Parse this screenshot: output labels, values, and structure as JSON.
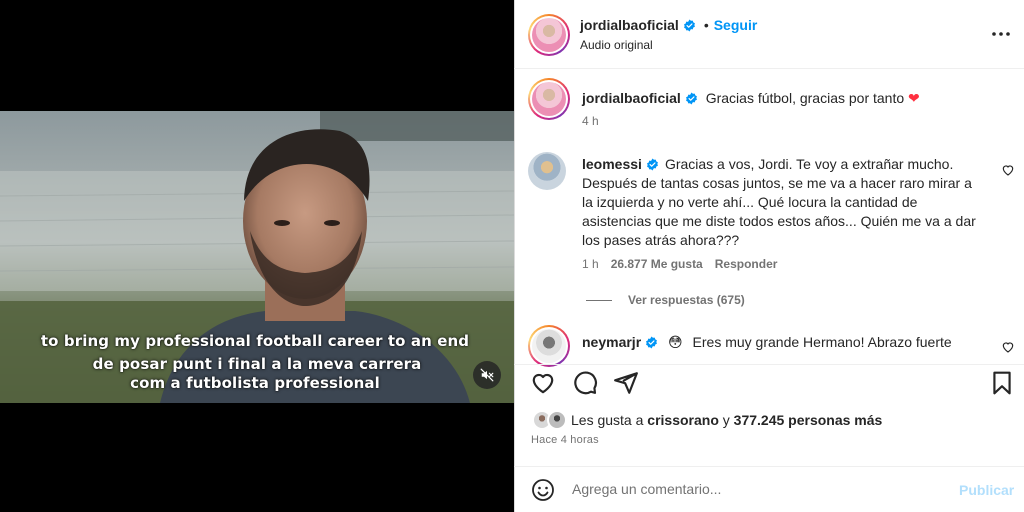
{
  "video": {
    "subtitle_en": "to bring my professional football career to an end",
    "subtitle_ca_1": "de posar punt i final a la meva carrera",
    "subtitle_ca_2": "com a futbolista professional",
    "mute_icon": "speaker-muted-icon"
  },
  "header": {
    "username": "jordialbaoficial",
    "follow_label": "Seguir",
    "dot": "•",
    "audio_label": "Audio original"
  },
  "caption": {
    "username": "jordialbaoficial",
    "text": "Gracias fútbol, gracias por tanto",
    "emoji": "❤",
    "time": "4 h"
  },
  "comments": [
    {
      "username": "leomessi",
      "text": "Gracias a vos, Jordi. Te voy a extrañar mucho. Después de tantas cosas juntos, se me va a hacer raro mirar a la izquierda y no verte ahí... Qué locura la cantidad de asistencias que me diste todos estos años... Quién me va a dar los pases atrás ahora???",
      "time": "1 h",
      "likes": "26.877 Me gusta",
      "reply_label": "Responder",
      "view_replies": "Ver respuestas (675)"
    },
    {
      "username": "neymarjr",
      "emoji": "😳",
      "text": "Eres muy grande Hermano! Abrazo fuerte"
    }
  ],
  "likes": {
    "prefix": "Les gusta a",
    "user": "crissorano",
    "conj": "y",
    "others": "377.245 personas más",
    "ago": "Hace 4 horas"
  },
  "composer": {
    "placeholder": "Agrega un comentario...",
    "post_label": "Publicar"
  },
  "colors": {
    "accent": "#0095f6",
    "verified": "#0095f6",
    "heart": "#ff3040"
  }
}
